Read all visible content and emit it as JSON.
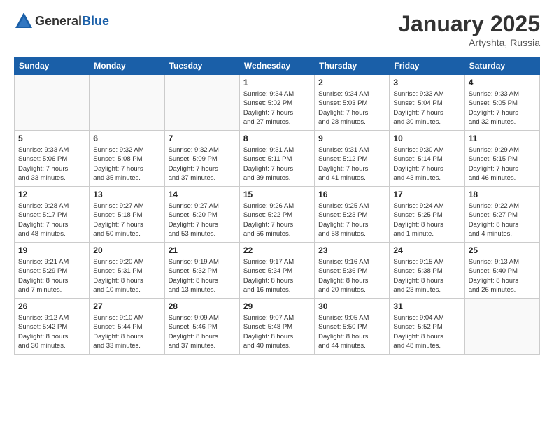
{
  "header": {
    "logo_general": "General",
    "logo_blue": "Blue",
    "month": "January 2025",
    "location": "Artyshta, Russia"
  },
  "weekdays": [
    "Sunday",
    "Monday",
    "Tuesday",
    "Wednesday",
    "Thursday",
    "Friday",
    "Saturday"
  ],
  "weeks": [
    [
      {
        "day": "",
        "info": ""
      },
      {
        "day": "",
        "info": ""
      },
      {
        "day": "",
        "info": ""
      },
      {
        "day": "1",
        "info": "Sunrise: 9:34 AM\nSunset: 5:02 PM\nDaylight: 7 hours\nand 27 minutes."
      },
      {
        "day": "2",
        "info": "Sunrise: 9:34 AM\nSunset: 5:03 PM\nDaylight: 7 hours\nand 28 minutes."
      },
      {
        "day": "3",
        "info": "Sunrise: 9:33 AM\nSunset: 5:04 PM\nDaylight: 7 hours\nand 30 minutes."
      },
      {
        "day": "4",
        "info": "Sunrise: 9:33 AM\nSunset: 5:05 PM\nDaylight: 7 hours\nand 32 minutes."
      }
    ],
    [
      {
        "day": "5",
        "info": "Sunrise: 9:33 AM\nSunset: 5:06 PM\nDaylight: 7 hours\nand 33 minutes."
      },
      {
        "day": "6",
        "info": "Sunrise: 9:32 AM\nSunset: 5:08 PM\nDaylight: 7 hours\nand 35 minutes."
      },
      {
        "day": "7",
        "info": "Sunrise: 9:32 AM\nSunset: 5:09 PM\nDaylight: 7 hours\nand 37 minutes."
      },
      {
        "day": "8",
        "info": "Sunrise: 9:31 AM\nSunset: 5:11 PM\nDaylight: 7 hours\nand 39 minutes."
      },
      {
        "day": "9",
        "info": "Sunrise: 9:31 AM\nSunset: 5:12 PM\nDaylight: 7 hours\nand 41 minutes."
      },
      {
        "day": "10",
        "info": "Sunrise: 9:30 AM\nSunset: 5:14 PM\nDaylight: 7 hours\nand 43 minutes."
      },
      {
        "day": "11",
        "info": "Sunrise: 9:29 AM\nSunset: 5:15 PM\nDaylight: 7 hours\nand 46 minutes."
      }
    ],
    [
      {
        "day": "12",
        "info": "Sunrise: 9:28 AM\nSunset: 5:17 PM\nDaylight: 7 hours\nand 48 minutes."
      },
      {
        "day": "13",
        "info": "Sunrise: 9:27 AM\nSunset: 5:18 PM\nDaylight: 7 hours\nand 50 minutes."
      },
      {
        "day": "14",
        "info": "Sunrise: 9:27 AM\nSunset: 5:20 PM\nDaylight: 7 hours\nand 53 minutes."
      },
      {
        "day": "15",
        "info": "Sunrise: 9:26 AM\nSunset: 5:22 PM\nDaylight: 7 hours\nand 56 minutes."
      },
      {
        "day": "16",
        "info": "Sunrise: 9:25 AM\nSunset: 5:23 PM\nDaylight: 7 hours\nand 58 minutes."
      },
      {
        "day": "17",
        "info": "Sunrise: 9:24 AM\nSunset: 5:25 PM\nDaylight: 8 hours\nand 1 minute."
      },
      {
        "day": "18",
        "info": "Sunrise: 9:22 AM\nSunset: 5:27 PM\nDaylight: 8 hours\nand 4 minutes."
      }
    ],
    [
      {
        "day": "19",
        "info": "Sunrise: 9:21 AM\nSunset: 5:29 PM\nDaylight: 8 hours\nand 7 minutes."
      },
      {
        "day": "20",
        "info": "Sunrise: 9:20 AM\nSunset: 5:31 PM\nDaylight: 8 hours\nand 10 minutes."
      },
      {
        "day": "21",
        "info": "Sunrise: 9:19 AM\nSunset: 5:32 PM\nDaylight: 8 hours\nand 13 minutes."
      },
      {
        "day": "22",
        "info": "Sunrise: 9:17 AM\nSunset: 5:34 PM\nDaylight: 8 hours\nand 16 minutes."
      },
      {
        "day": "23",
        "info": "Sunrise: 9:16 AM\nSunset: 5:36 PM\nDaylight: 8 hours\nand 20 minutes."
      },
      {
        "day": "24",
        "info": "Sunrise: 9:15 AM\nSunset: 5:38 PM\nDaylight: 8 hours\nand 23 minutes."
      },
      {
        "day": "25",
        "info": "Sunrise: 9:13 AM\nSunset: 5:40 PM\nDaylight: 8 hours\nand 26 minutes."
      }
    ],
    [
      {
        "day": "26",
        "info": "Sunrise: 9:12 AM\nSunset: 5:42 PM\nDaylight: 8 hours\nand 30 minutes."
      },
      {
        "day": "27",
        "info": "Sunrise: 9:10 AM\nSunset: 5:44 PM\nDaylight: 8 hours\nand 33 minutes."
      },
      {
        "day": "28",
        "info": "Sunrise: 9:09 AM\nSunset: 5:46 PM\nDaylight: 8 hours\nand 37 minutes."
      },
      {
        "day": "29",
        "info": "Sunrise: 9:07 AM\nSunset: 5:48 PM\nDaylight: 8 hours\nand 40 minutes."
      },
      {
        "day": "30",
        "info": "Sunrise: 9:05 AM\nSunset: 5:50 PM\nDaylight: 8 hours\nand 44 minutes."
      },
      {
        "day": "31",
        "info": "Sunrise: 9:04 AM\nSunset: 5:52 PM\nDaylight: 8 hours\nand 48 minutes."
      },
      {
        "day": "",
        "info": ""
      }
    ]
  ]
}
